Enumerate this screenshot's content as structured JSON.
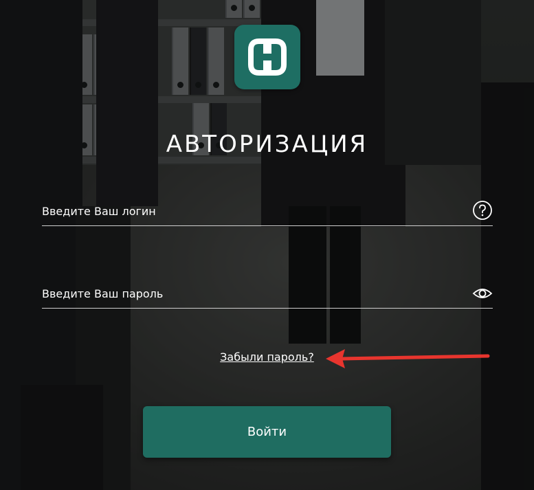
{
  "login_form": {
    "title": "АВТОРИЗАЦИЯ",
    "login_placeholder": "Введите Ваш логин",
    "login_value": "",
    "password_placeholder": "Введите Ваш пароль",
    "password_value": "",
    "forgot_password_label": "Забыли пароль?",
    "submit_label": "Войти"
  },
  "icons": {
    "logo": "logo-icon",
    "login_help": "question-icon",
    "password_toggle": "eye-icon",
    "annotation_arrow": "arrow-icon"
  },
  "colors": {
    "accent": "#1f6d61",
    "logo_background": "#1e6e63",
    "annotation_arrow": "#e8352e",
    "text": "#ffffff"
  }
}
